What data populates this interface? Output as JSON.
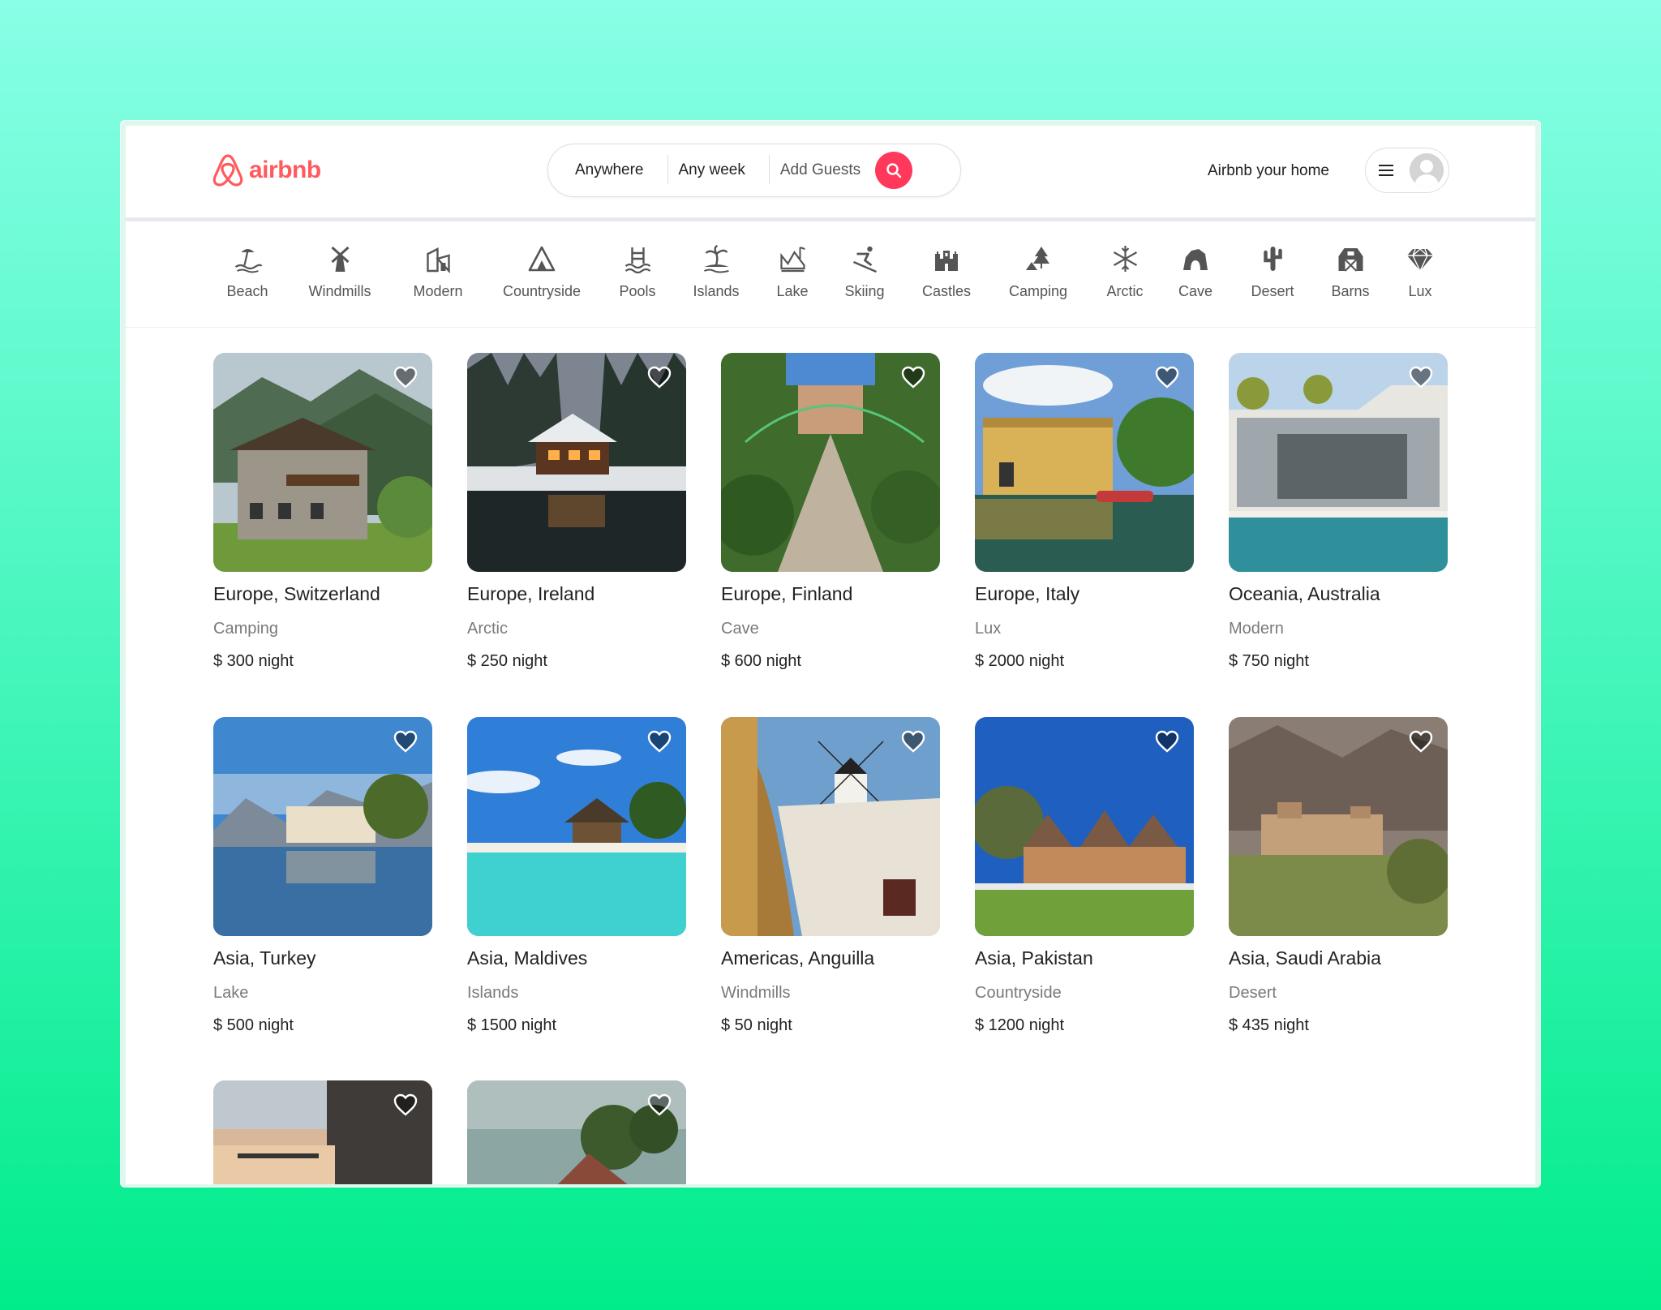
{
  "header": {
    "logo_text": "airbnb",
    "search": {
      "location": "Anywhere",
      "week": "Any week",
      "guests": "Add Guests"
    },
    "host_link": "Airbnb your home"
  },
  "categories": [
    {
      "label": "Beach",
      "icon": "beach-icon"
    },
    {
      "label": "Windmills",
      "icon": "windmill-icon"
    },
    {
      "label": "Modern",
      "icon": "modern-house-icon"
    },
    {
      "label": "Countryside",
      "icon": "tent-icon"
    },
    {
      "label": "Pools",
      "icon": "pool-icon"
    },
    {
      "label": "Islands",
      "icon": "palm-island-icon"
    },
    {
      "label": "Lake",
      "icon": "lake-icon"
    },
    {
      "label": "Skiing",
      "icon": "skier-icon"
    },
    {
      "label": "Castles",
      "icon": "castle-icon"
    },
    {
      "label": "Camping",
      "icon": "camping-tree-icon"
    },
    {
      "label": "Arctic",
      "icon": "snowflake-icon"
    },
    {
      "label": "Cave",
      "icon": "cave-icon"
    },
    {
      "label": "Desert",
      "icon": "cactus-icon"
    },
    {
      "label": "Barns",
      "icon": "barn-icon"
    },
    {
      "label": "Lux",
      "icon": "diamond-icon"
    }
  ],
  "listings": [
    {
      "title": "Europe, Switzerland",
      "category": "Camping",
      "price_prefix": "$ 300",
      "price_suffix": " night"
    },
    {
      "title": "Europe, Ireland",
      "category": "Arctic",
      "price_prefix": "$ 250",
      "price_suffix": " night"
    },
    {
      "title": "Europe, Finland",
      "category": "Cave",
      "price_prefix": "$ 600",
      "price_suffix": " night"
    },
    {
      "title": "Europe, Italy",
      "category": "Lux",
      "price_prefix": "$ 2000",
      "price_suffix": " night"
    },
    {
      "title": "Oceania, Australia",
      "category": "Modern",
      "price_prefix": "$ 750",
      "price_suffix": " night"
    },
    {
      "title": "Asia, Turkey",
      "category": "Lake",
      "price_prefix": "$ 500",
      "price_suffix": " night"
    },
    {
      "title": "Asia, Maldives",
      "category": "Islands",
      "price_prefix": "$ 1500",
      "price_suffix": " night"
    },
    {
      "title": "Americas, Anguilla",
      "category": "Windmills",
      "price_prefix": "$ 50",
      "price_suffix": " night"
    },
    {
      "title": "Asia, Pakistan",
      "category": "Countryside",
      "price_prefix": "$ 1200",
      "price_suffix": " night"
    },
    {
      "title": "Asia, Saudi Arabia",
      "category": "Desert",
      "price_prefix": "$ 435",
      "price_suffix": " night"
    }
  ],
  "colors": {
    "brand": "#ff5a5f",
    "search_button": "#ff385c"
  }
}
